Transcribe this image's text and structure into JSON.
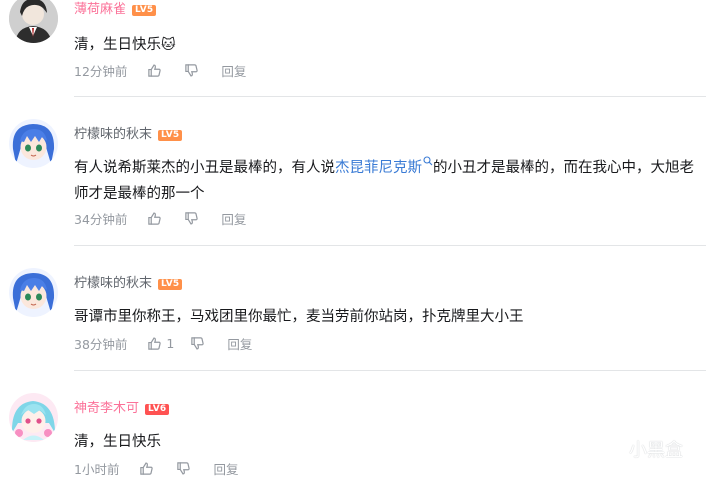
{
  "comments": [
    {
      "username": "薄荷麻雀",
      "level": "LV5",
      "text": "清，生日快乐",
      "emoji": "🐱",
      "time": "12分钟前",
      "reply": "回复"
    },
    {
      "username": "柠檬味的秋末",
      "level": "LV5",
      "text_before": "有人说希斯莱杰的小丑是最棒的，有人说",
      "tag_text": "杰昆菲尼克斯",
      "text_after": "的小丑才是最棒的，而在我心中，大旭老师才是最棒的那一个",
      "time": "34分钟前",
      "reply": "回复"
    },
    {
      "username": "柠檬味的秋末",
      "level": "LV5",
      "text": "哥谭市里你称王，马戏团里你最忙，麦当劳前你站岗，扑克牌里大小王",
      "time": "38分钟前",
      "like_count": "1",
      "reply": "回复"
    },
    {
      "username": "神奇李木可",
      "level": "LV6",
      "text": "清，生日快乐",
      "time": "1小时前",
      "reply": "回复"
    }
  ],
  "watermark": {
    "text": "小黑盒"
  },
  "colors": {
    "vip_name": "#fb7299",
    "level5": "#ff9049",
    "level6": "#ff5252",
    "link": "#3a7bd5",
    "meta": "#9499a0"
  }
}
